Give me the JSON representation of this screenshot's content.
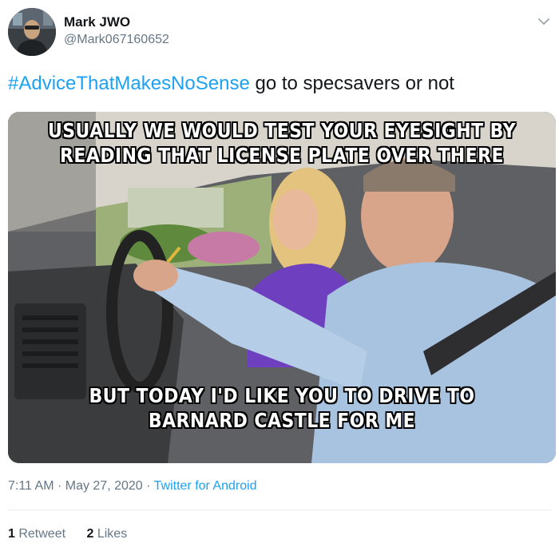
{
  "author": {
    "display_name": "Mark JWO",
    "handle": "@Mark067160652"
  },
  "tweet": {
    "hashtag": "#AdviceThatMakesNoSense",
    "text": " go to specsavers or not"
  },
  "media": {
    "top_caption_line1": "USUALLY WE WOULD TEST YOUR EYESIGHT BY",
    "top_caption_line2": "READING THAT LICENSE PLATE OVER THERE",
    "bottom_caption_line1": "BUT TODAY I'D LIKE YOU TO DRIVE TO",
    "bottom_caption_line2": "BARNARD CASTLE FOR ME"
  },
  "meta": {
    "time": "7:11 AM",
    "separator1": " · ",
    "date": "May 27, 2020",
    "separator2": " · ",
    "source": "Twitter for Android"
  },
  "stats": {
    "retweets_count": "1",
    "retweets_label": " Retweet",
    "likes_count": "2",
    "likes_label": " Likes"
  },
  "colors": {
    "link": "#1da1f2",
    "secondary_text": "#657786",
    "primary_text": "#14171a"
  },
  "icons": {
    "menu": "chevron-down-icon"
  }
}
